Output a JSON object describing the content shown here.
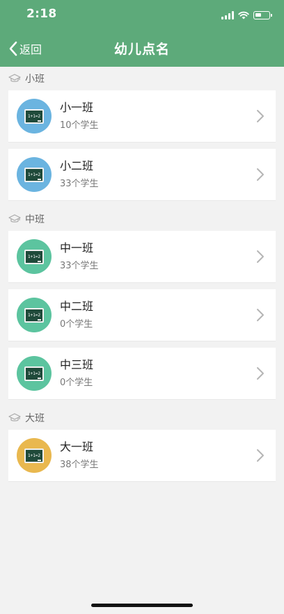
{
  "status_bar": {
    "time": "2:18"
  },
  "nav": {
    "back_label": "返回",
    "title": "幼儿点名"
  },
  "sections": [
    {
      "title": "小班",
      "classes": [
        {
          "name": "小一班",
          "count": "10个学生",
          "color": "#6bb4e0"
        },
        {
          "name": "小二班",
          "count": "33个学生",
          "color": "#6bb4e0"
        }
      ]
    },
    {
      "title": "中班",
      "classes": [
        {
          "name": "中一班",
          "count": "33个学生",
          "color": "#5cc49f"
        },
        {
          "name": "中二班",
          "count": "0个学生",
          "color": "#5cc49f"
        },
        {
          "name": "中三班",
          "count": "0个学生",
          "color": "#5cc49f"
        }
      ]
    },
    {
      "title": "大班",
      "classes": [
        {
          "name": "大一班",
          "count": "38个学生",
          "color": "#e9b84f"
        }
      ]
    }
  ],
  "board_label": "1+1=2",
  "colors": {
    "header": "#5daa7a",
    "background": "#f2f2f2"
  }
}
